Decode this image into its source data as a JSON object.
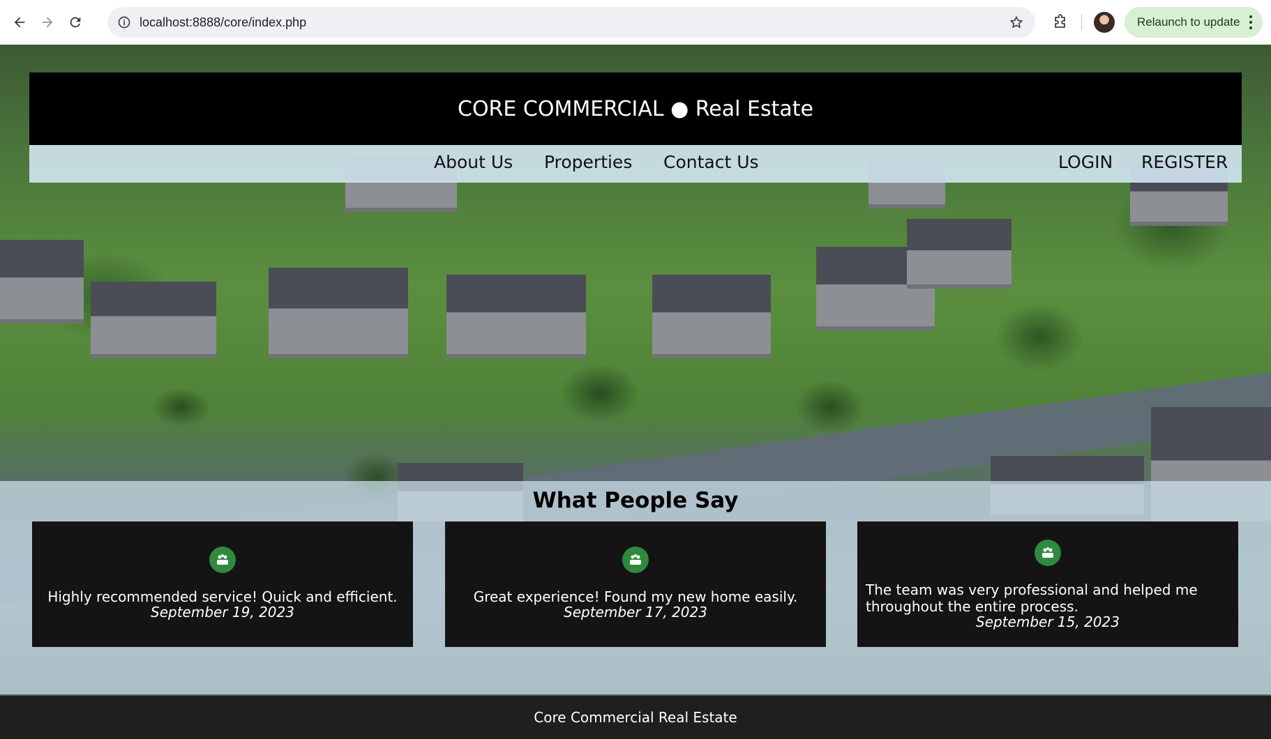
{
  "browser": {
    "url": "localhost:8888/core/index.php",
    "relaunch_label": "Relaunch to update"
  },
  "site": {
    "title": "CORE COMMERCIAL ● Real Estate",
    "nav": {
      "about": "About Us",
      "properties": "Properties",
      "contact": "Contact Us",
      "login": "LOGIN",
      "register": "REGISTER"
    }
  },
  "testimonials": {
    "heading": "What People Say",
    "items": [
      {
        "quote": "Highly recommended service! Quick and efficient.",
        "date": "September 19, 2023"
      },
      {
        "quote": "Great experience! Found my new home easily.",
        "date": "September 17, 2023"
      },
      {
        "quote": "The team was very professional and helped me throughout the entire process.",
        "date": "September 15, 2023"
      }
    ]
  },
  "footer": {
    "text": "Core Commercial Real Estate"
  },
  "colors": {
    "header_bg": "#000000",
    "nav_bg": "#cde2ec",
    "card_bg": "#141414",
    "icon_green": "#2f8a3e",
    "footer_bg": "#1f1f1f",
    "relaunch_bg": "#d7f0d3"
  },
  "icons": {
    "back": "back-arrow-icon",
    "forward": "forward-arrow-icon",
    "reload": "reload-icon",
    "site_info": "info-icon",
    "bookmark": "star-icon",
    "extensions": "puzzle-icon",
    "testimonial": "users-group-icon"
  }
}
